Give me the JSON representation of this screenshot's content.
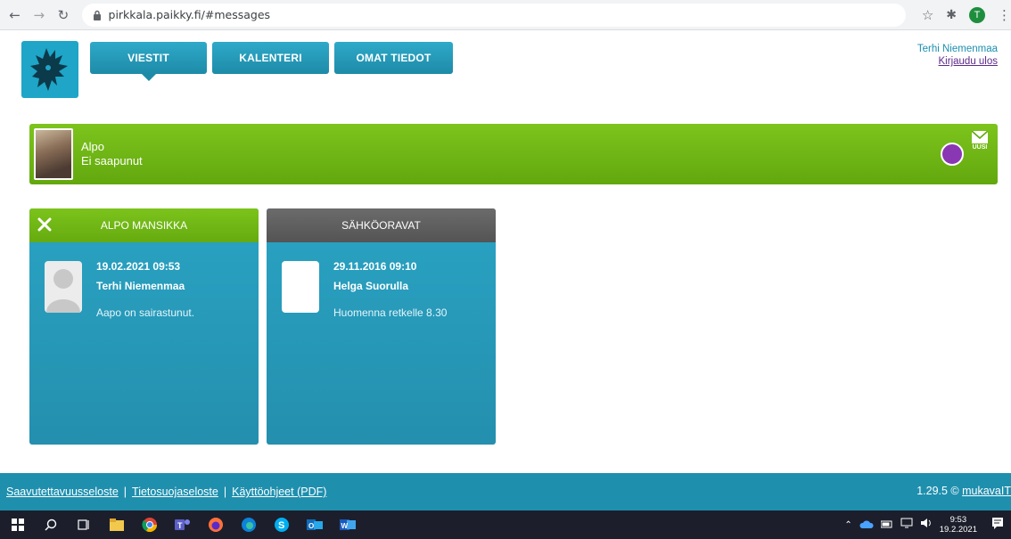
{
  "browser": {
    "url": "pirkkala.paikky.fi/#messages",
    "profile_initial": "T"
  },
  "header": {
    "tabs": [
      {
        "label": "VIESTIT",
        "active": true
      },
      {
        "label": "KALENTERI",
        "active": false
      },
      {
        "label": "OMAT TIEDOT",
        "active": false
      }
    ],
    "user_name": "Terhi Niemenmaa",
    "logout_label": "Kirjaudu ulos"
  },
  "child": {
    "name": "Alpo",
    "status": "Ei saapunut",
    "status_color": "#8a37b3",
    "new_label": "UUSI"
  },
  "threads": [
    {
      "title": "ALPO MANSIKKA",
      "header_color": "#72b816",
      "date": "19.02.2021 09:53",
      "author": "Terhi Niemenmaa",
      "preview": "Aapo on sairastunut."
    },
    {
      "title": "SÄHKÖORAVAT",
      "header_color": "#5f5f5f",
      "date": "29.11.2016 09:10",
      "author": "Helga Suorulla",
      "preview": "Huomenna retkelle 8.30"
    }
  ],
  "footer": {
    "links": [
      "Saavutettavuusseloste",
      "Tietosuojaseloste",
      "Käyttöohjeet (PDF)"
    ],
    "version": "1.29.5 ©",
    "brand": "mukavaIT"
  },
  "taskbar": {
    "time": "9:53",
    "date": "19.2.2021"
  },
  "colors": {
    "brand_blue": "#2aa3c3",
    "green": "#72b816",
    "footer_blue": "#1f8fae"
  }
}
